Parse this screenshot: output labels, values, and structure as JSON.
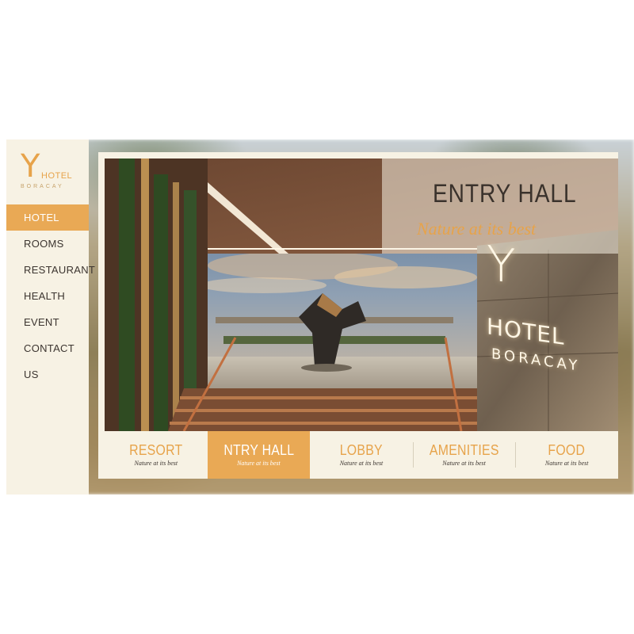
{
  "brand": {
    "logo_letter": "Y",
    "logo_word": "HOTEL",
    "logo_sub": "BORACAY"
  },
  "sidebar": {
    "items": [
      {
        "label": "HOTEL",
        "active": true
      },
      {
        "label": "ROOMS",
        "active": false
      },
      {
        "label": "RESTAURANT",
        "active": false
      },
      {
        "label": "HEALTH",
        "active": false
      },
      {
        "label": "EVENT",
        "active": false
      },
      {
        "label": "CONTACT US",
        "active": false
      }
    ]
  },
  "hero": {
    "title": "ENTRY HALL",
    "subtitle": "Nature at its best",
    "sign_letter": "Y",
    "sign_word": "HOTEL",
    "sign_sub": "BORACAY"
  },
  "tabs": [
    {
      "label": "RESORT",
      "sub": "Nature at its best",
      "active": false
    },
    {
      "label": "NTRY HALL",
      "sub": "Nature at its best",
      "active": true
    },
    {
      "label": "LOBBY",
      "sub": "Nature at its best",
      "active": false
    },
    {
      "label": "AMENITIES",
      "sub": "Nature at its best",
      "active": false
    },
    {
      "label": "FOOD",
      "sub": "Nature at its best",
      "active": false
    }
  ],
  "colors": {
    "accent": "#e9a955",
    "panel": "#f7f2e4",
    "text_dark": "#3c3530"
  }
}
